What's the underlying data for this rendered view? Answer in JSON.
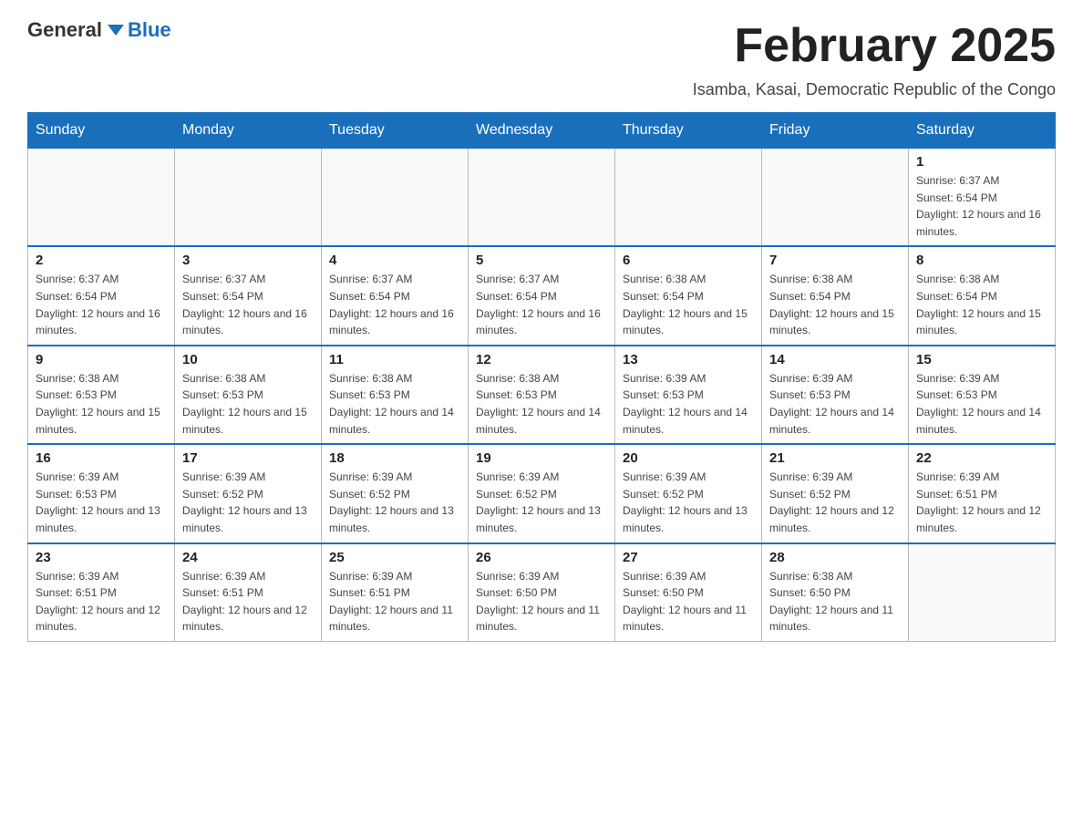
{
  "logo": {
    "general": "General",
    "blue": "Blue"
  },
  "title": "February 2025",
  "subtitle": "Isamba, Kasai, Democratic Republic of the Congo",
  "days_of_week": [
    "Sunday",
    "Monday",
    "Tuesday",
    "Wednesday",
    "Thursday",
    "Friday",
    "Saturday"
  ],
  "weeks": [
    [
      {
        "day": "",
        "info": ""
      },
      {
        "day": "",
        "info": ""
      },
      {
        "day": "",
        "info": ""
      },
      {
        "day": "",
        "info": ""
      },
      {
        "day": "",
        "info": ""
      },
      {
        "day": "",
        "info": ""
      },
      {
        "day": "1",
        "info": "Sunrise: 6:37 AM\nSunset: 6:54 PM\nDaylight: 12 hours and 16 minutes."
      }
    ],
    [
      {
        "day": "2",
        "info": "Sunrise: 6:37 AM\nSunset: 6:54 PM\nDaylight: 12 hours and 16 minutes."
      },
      {
        "day": "3",
        "info": "Sunrise: 6:37 AM\nSunset: 6:54 PM\nDaylight: 12 hours and 16 minutes."
      },
      {
        "day": "4",
        "info": "Sunrise: 6:37 AM\nSunset: 6:54 PM\nDaylight: 12 hours and 16 minutes."
      },
      {
        "day": "5",
        "info": "Sunrise: 6:37 AM\nSunset: 6:54 PM\nDaylight: 12 hours and 16 minutes."
      },
      {
        "day": "6",
        "info": "Sunrise: 6:38 AM\nSunset: 6:54 PM\nDaylight: 12 hours and 15 minutes."
      },
      {
        "day": "7",
        "info": "Sunrise: 6:38 AM\nSunset: 6:54 PM\nDaylight: 12 hours and 15 minutes."
      },
      {
        "day": "8",
        "info": "Sunrise: 6:38 AM\nSunset: 6:54 PM\nDaylight: 12 hours and 15 minutes."
      }
    ],
    [
      {
        "day": "9",
        "info": "Sunrise: 6:38 AM\nSunset: 6:53 PM\nDaylight: 12 hours and 15 minutes."
      },
      {
        "day": "10",
        "info": "Sunrise: 6:38 AM\nSunset: 6:53 PM\nDaylight: 12 hours and 15 minutes."
      },
      {
        "day": "11",
        "info": "Sunrise: 6:38 AM\nSunset: 6:53 PM\nDaylight: 12 hours and 14 minutes."
      },
      {
        "day": "12",
        "info": "Sunrise: 6:38 AM\nSunset: 6:53 PM\nDaylight: 12 hours and 14 minutes."
      },
      {
        "day": "13",
        "info": "Sunrise: 6:39 AM\nSunset: 6:53 PM\nDaylight: 12 hours and 14 minutes."
      },
      {
        "day": "14",
        "info": "Sunrise: 6:39 AM\nSunset: 6:53 PM\nDaylight: 12 hours and 14 minutes."
      },
      {
        "day": "15",
        "info": "Sunrise: 6:39 AM\nSunset: 6:53 PM\nDaylight: 12 hours and 14 minutes."
      }
    ],
    [
      {
        "day": "16",
        "info": "Sunrise: 6:39 AM\nSunset: 6:53 PM\nDaylight: 12 hours and 13 minutes."
      },
      {
        "day": "17",
        "info": "Sunrise: 6:39 AM\nSunset: 6:52 PM\nDaylight: 12 hours and 13 minutes."
      },
      {
        "day": "18",
        "info": "Sunrise: 6:39 AM\nSunset: 6:52 PM\nDaylight: 12 hours and 13 minutes."
      },
      {
        "day": "19",
        "info": "Sunrise: 6:39 AM\nSunset: 6:52 PM\nDaylight: 12 hours and 13 minutes."
      },
      {
        "day": "20",
        "info": "Sunrise: 6:39 AM\nSunset: 6:52 PM\nDaylight: 12 hours and 13 minutes."
      },
      {
        "day": "21",
        "info": "Sunrise: 6:39 AM\nSunset: 6:52 PM\nDaylight: 12 hours and 12 minutes."
      },
      {
        "day": "22",
        "info": "Sunrise: 6:39 AM\nSunset: 6:51 PM\nDaylight: 12 hours and 12 minutes."
      }
    ],
    [
      {
        "day": "23",
        "info": "Sunrise: 6:39 AM\nSunset: 6:51 PM\nDaylight: 12 hours and 12 minutes."
      },
      {
        "day": "24",
        "info": "Sunrise: 6:39 AM\nSunset: 6:51 PM\nDaylight: 12 hours and 12 minutes."
      },
      {
        "day": "25",
        "info": "Sunrise: 6:39 AM\nSunset: 6:51 PM\nDaylight: 12 hours and 11 minutes."
      },
      {
        "day": "26",
        "info": "Sunrise: 6:39 AM\nSunset: 6:50 PM\nDaylight: 12 hours and 11 minutes."
      },
      {
        "day": "27",
        "info": "Sunrise: 6:39 AM\nSunset: 6:50 PM\nDaylight: 12 hours and 11 minutes."
      },
      {
        "day": "28",
        "info": "Sunrise: 6:38 AM\nSunset: 6:50 PM\nDaylight: 12 hours and 11 minutes."
      },
      {
        "day": "",
        "info": ""
      }
    ]
  ]
}
